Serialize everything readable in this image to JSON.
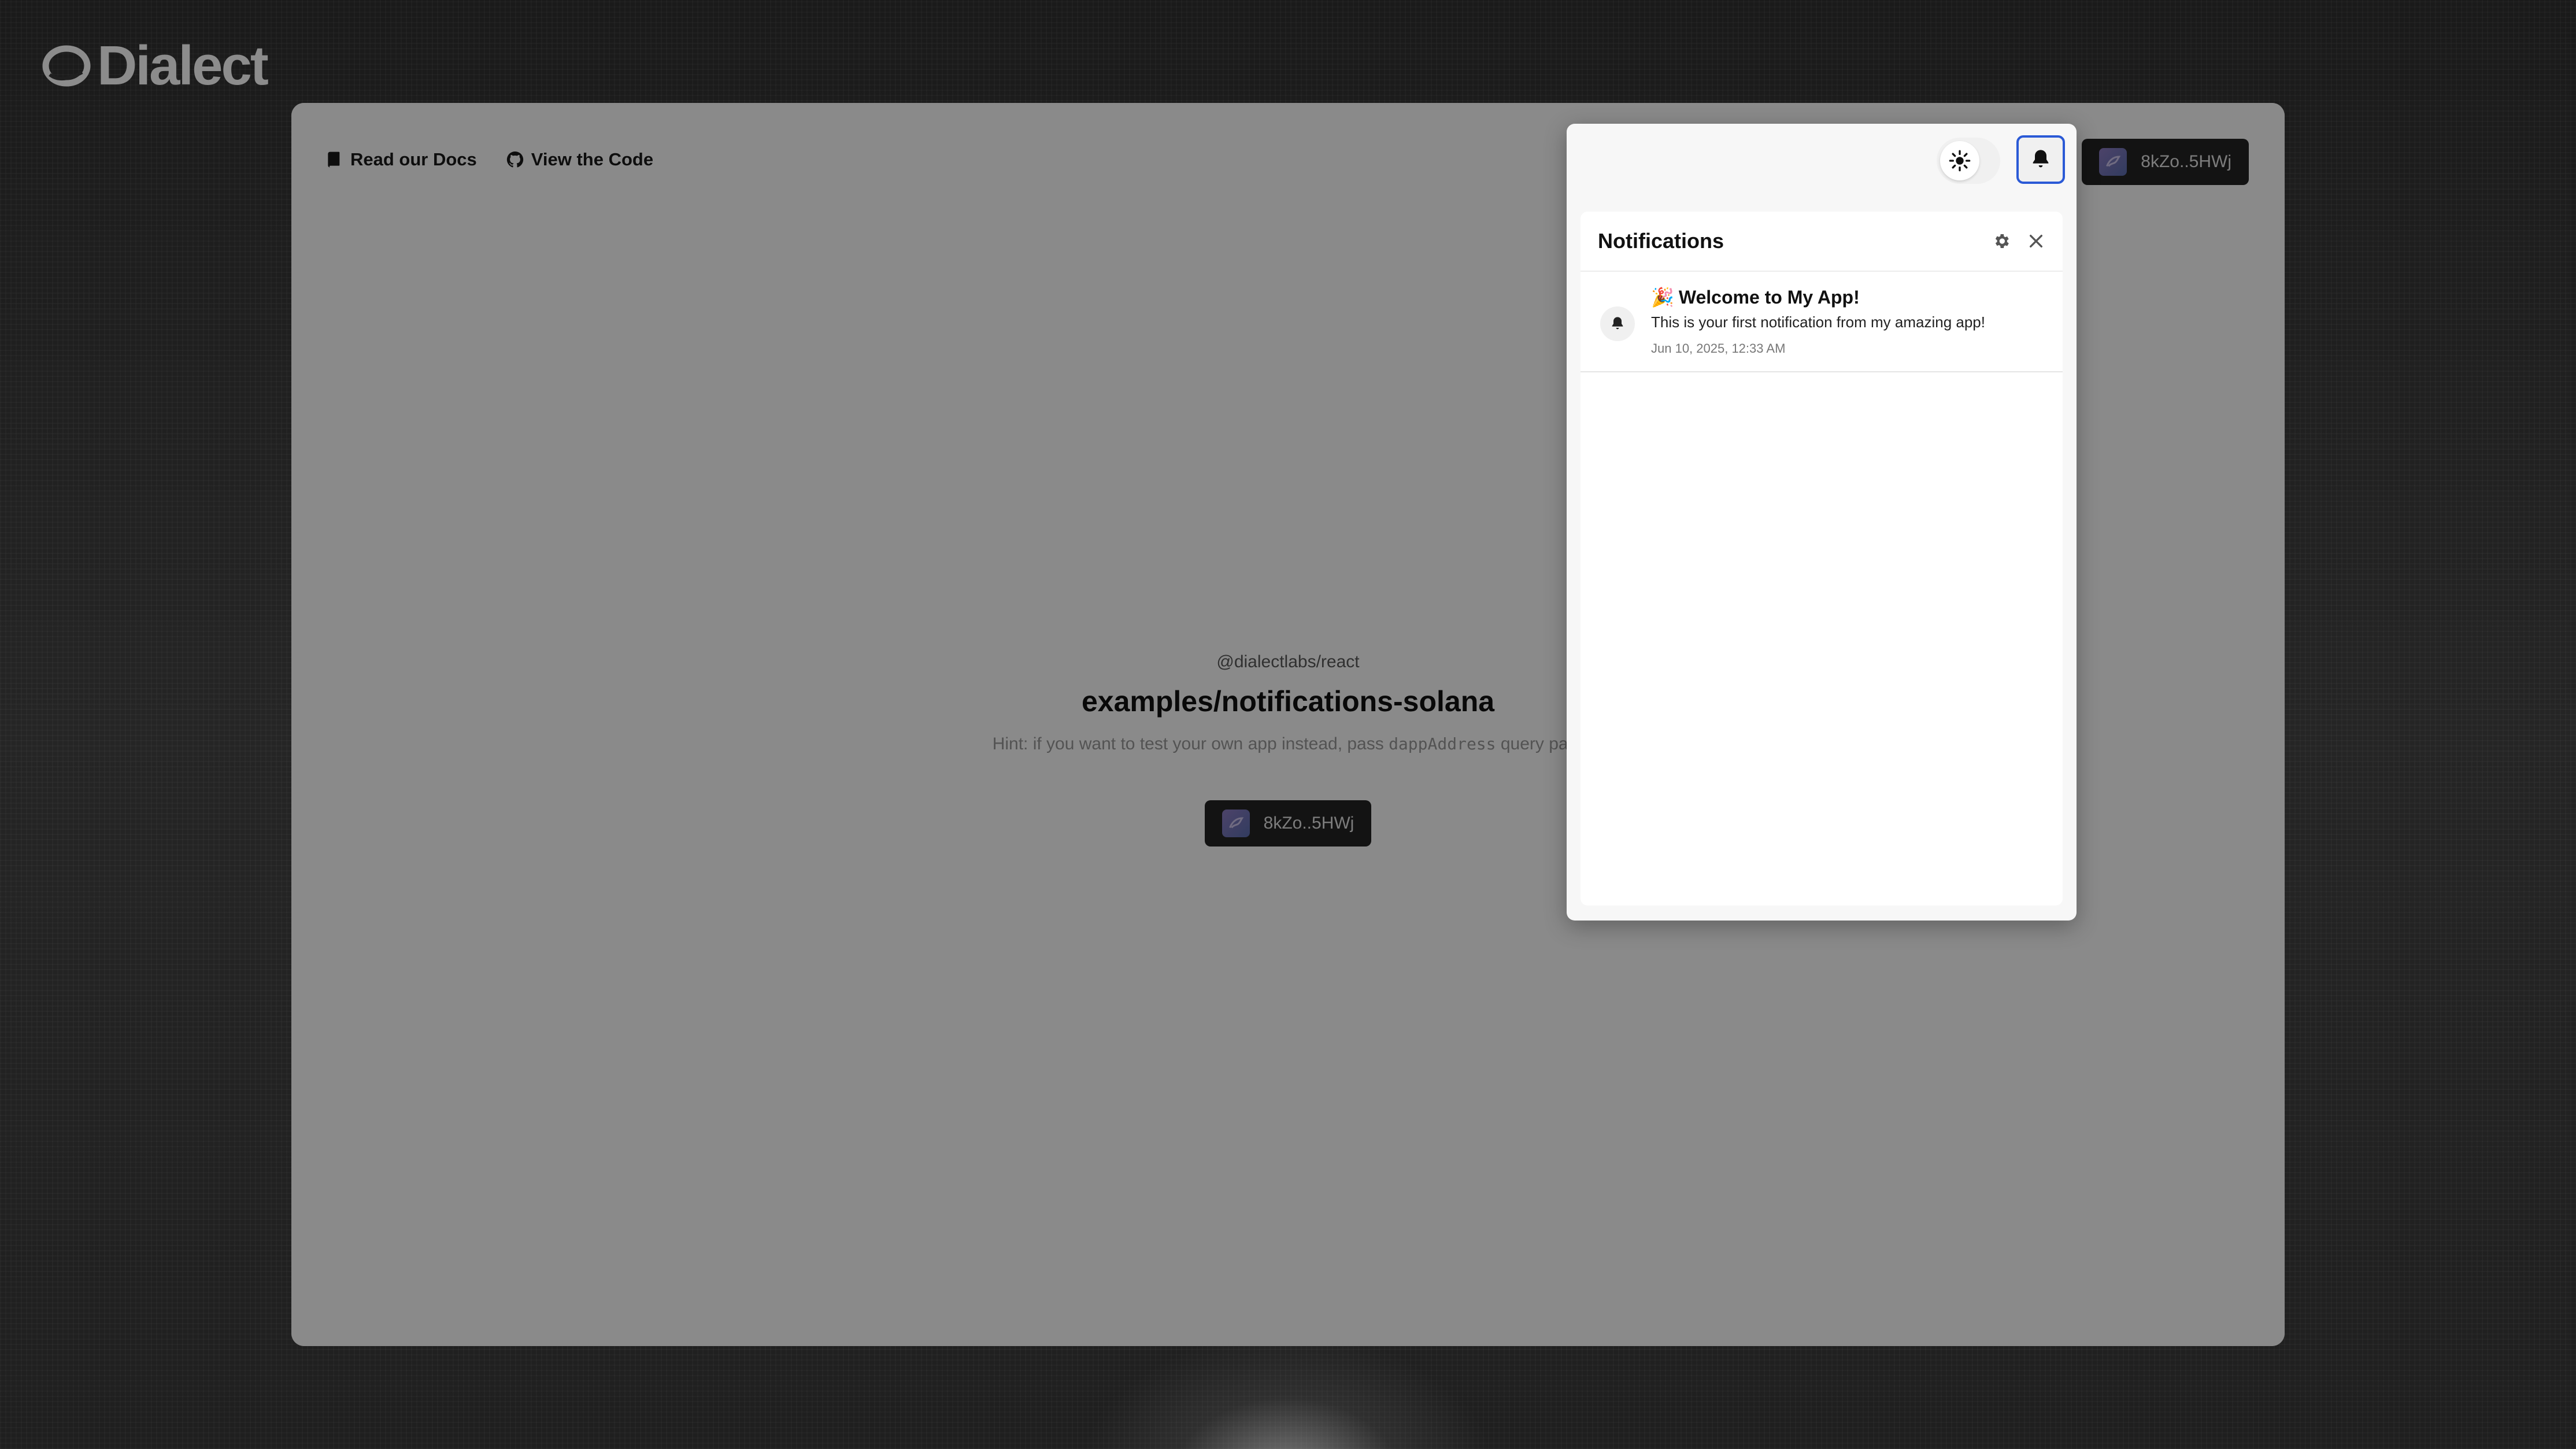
{
  "brand": {
    "name": "Dialect"
  },
  "nav": {
    "docs": {
      "label": "Read our Docs",
      "icon": "book-icon"
    },
    "code": {
      "label": "View the Code",
      "icon": "github-icon"
    }
  },
  "hero": {
    "subtitle": "@dialectlabs/react",
    "title": "examples/notifications-solana",
    "hint_prefix": "Hint: if you want to test your own app instead, pass ",
    "hint_code": "dappAddress",
    "hint_suffix": " query para"
  },
  "wallet": {
    "address": "8kZo..5HWj",
    "avatar_icon": "wallet-avatar-icon"
  },
  "toolbar": {
    "theme_icon": "sun-icon",
    "bell_icon": "bell-icon"
  },
  "notifications": {
    "title": "Notifications",
    "settings_icon": "gear-icon",
    "close_icon": "close-icon",
    "items": [
      {
        "emoji": "🎉",
        "title": "Welcome to My App!",
        "body": "This is your first notification from my amazing app!",
        "time": "Jun 10, 2025, 12:33 AM",
        "icon": "bell-icon"
      }
    ]
  },
  "colors": {
    "accent": "#2b5ad6",
    "wallet_bg": "#232323",
    "page_bg": "#1f1f1f",
    "overlay": "rgba(0,0,0,0.46)"
  }
}
